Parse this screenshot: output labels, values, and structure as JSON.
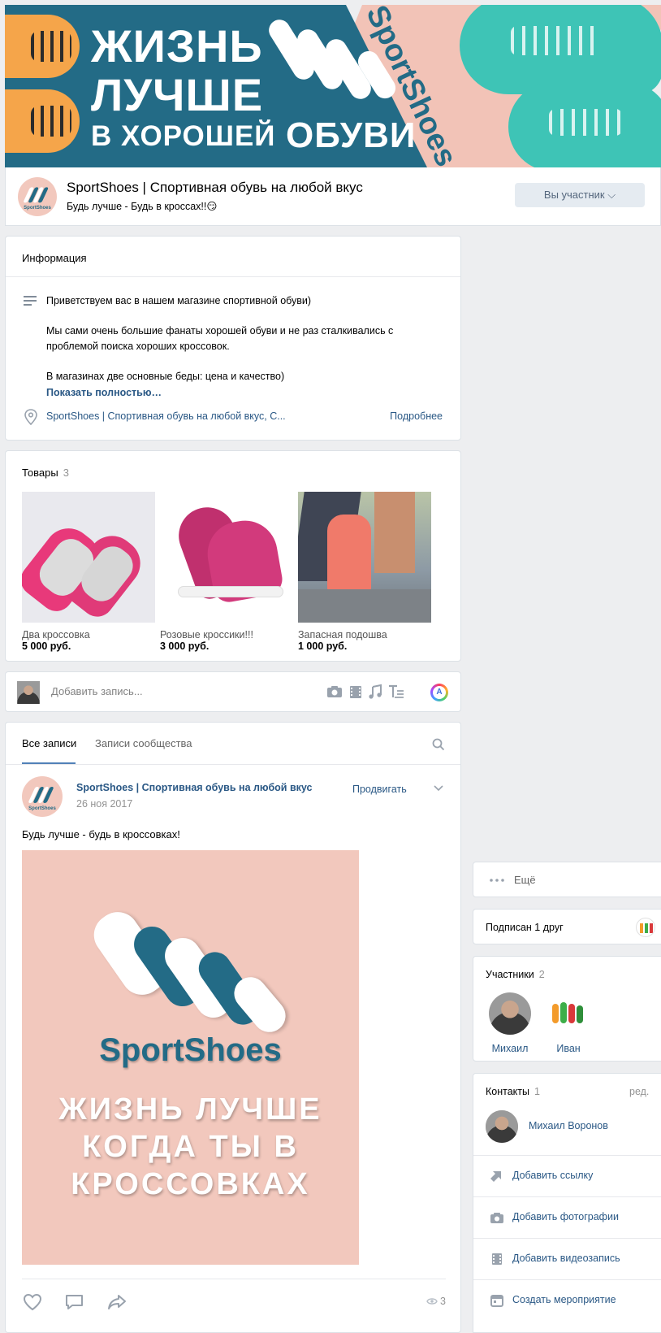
{
  "cover": {
    "line1": "ЖИЗНЬ",
    "line2": "ЛУЧШЕ",
    "line3a": "В ХОРОШЕЙ",
    "line3b": "ОБУВИ",
    "brand": "SportShoes"
  },
  "header": {
    "title": "SportShoes | Спортивная обувь на любой вкус",
    "status": "Будь лучше - Будь в кроссах!!😏",
    "member_button": "Вы участник ⌵",
    "avatar_brand": "SportShoes"
  },
  "info": {
    "title": "Информация",
    "paragraph1": "Приветствуем вас в нашем магазине спортивной обуви)",
    "paragraph2": "Мы сами очень большие фанаты хорошей обуви и не раз сталкивались с проблемой поиска хороших кроссовок.",
    "paragraph3": "В магазинах две основные беды: цена и качество)",
    "show_more": "Показать полностью…",
    "address": "SportShoes | Спортивная обувь на любой вкус, С...",
    "details": "Подробнее"
  },
  "goods": {
    "title": "Товары",
    "count": "3",
    "items": [
      {
        "name": "Два кроссовка",
        "price": "5 000 руб."
      },
      {
        "name": "Розовые кроссики!!!",
        "price": "3 000 руб."
      },
      {
        "name": "Запасная подошва",
        "price": "1 000 руб."
      }
    ]
  },
  "composer": {
    "placeholder": "Добавить запись...",
    "app_letter": "A"
  },
  "wall": {
    "tabs": [
      "Все записи",
      "Записи сообщества"
    ],
    "post": {
      "author": "SportShoes | Спортивная обувь на любой вкус",
      "date": "26 ноя 2017",
      "promote": "Продвигать",
      "text": "Будь лучше - будь в кроссовках!",
      "image_brand": "SportShoes",
      "image_line1": "ЖИЗНЬ ЛУЧШЕ",
      "image_line2": "КОГДА ТЫ В",
      "image_line3": "КРОССОВКАХ",
      "avatar_brand": "SportShoes",
      "views": "3"
    }
  },
  "sidebar": {
    "more_label": "Ещё",
    "friend_label": "Подписан 1 друг",
    "members": {
      "title": "Участники",
      "count": "2",
      "people": [
        "Михаил",
        "Иван"
      ]
    },
    "contacts": {
      "title": "Контакты",
      "count": "1",
      "edit": "ред.",
      "person": "Михаил Воронов"
    },
    "actions": [
      "Добавить ссылку",
      "Добавить фотографии",
      "Добавить видеозапись",
      "Создать мероприятие"
    ]
  },
  "colors": {
    "accent": "#5181b8",
    "link": "#2a5885",
    "brand_teal": "#236b86",
    "brand_pink": "#f2c8bd",
    "background": "#edeef0"
  }
}
